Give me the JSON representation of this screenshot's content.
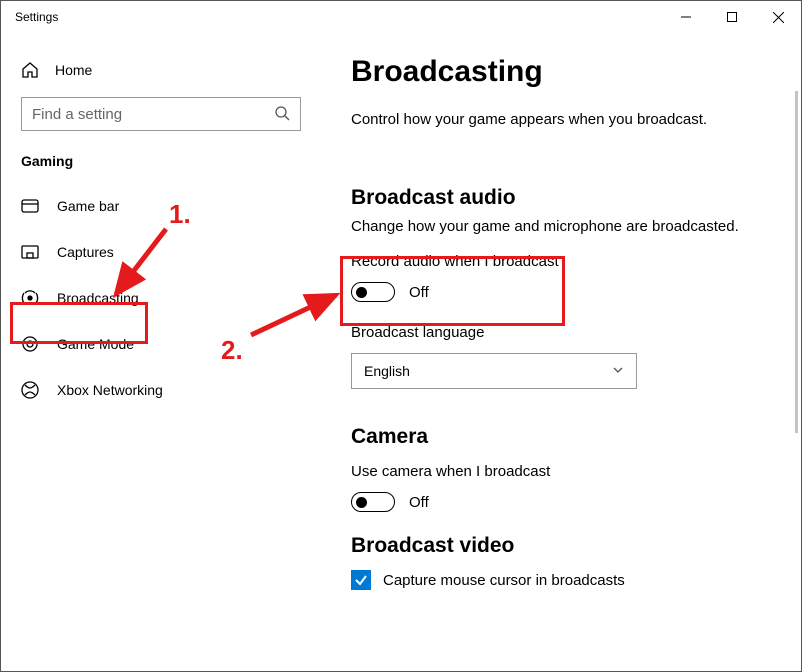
{
  "window": {
    "title": "Settings"
  },
  "sidebar": {
    "home_label": "Home",
    "search_placeholder": "Find a setting",
    "section_label": "Gaming",
    "items": [
      {
        "label": "Game bar"
      },
      {
        "label": "Captures"
      },
      {
        "label": "Broadcasting"
      },
      {
        "label": "Game Mode"
      },
      {
        "label": "Xbox Networking"
      }
    ]
  },
  "page": {
    "title": "Broadcasting",
    "description": "Control how your game appears when you broadcast.",
    "audio": {
      "heading": "Broadcast audio",
      "description": "Change how your game and microphone are broadcasted.",
      "record_label": "Record audio when I broadcast",
      "record_state": "Off",
      "language_label": "Broadcast language",
      "language_value": "English"
    },
    "camera": {
      "heading": "Camera",
      "use_label": "Use camera when I broadcast",
      "use_state": "Off"
    },
    "video": {
      "heading": "Broadcast video",
      "cursor_label": "Capture mouse cursor in broadcasts"
    }
  },
  "annotations": {
    "step1": "1.",
    "step2": "2."
  }
}
